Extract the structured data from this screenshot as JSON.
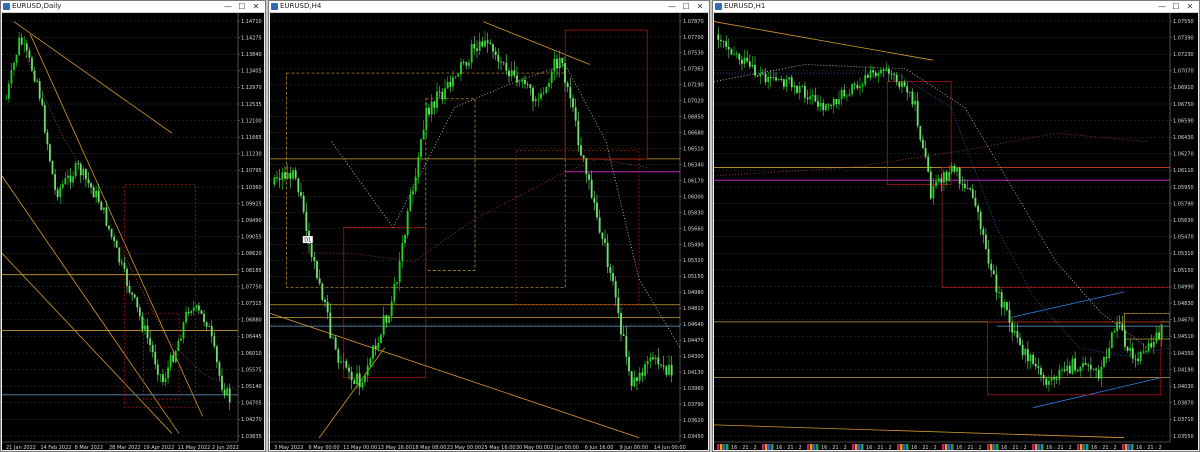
{
  "windows": [
    {
      "id": "daily",
      "title": "EURUSD,Daily",
      "price_labels": [
        "1.14710",
        "1.14275",
        "1.13840",
        "1.13405",
        "1.12970",
        "1.12535",
        "1.12100",
        "1.11665",
        "1.11230",
        "1.10795",
        "1.10360",
        "1.09925",
        "1.09490",
        "1.09055",
        "1.08620",
        "1.08185",
        "1.07750",
        "1.07315",
        "1.06880",
        "1.06445",
        "1.06010",
        "1.05575",
        "1.05140",
        "1.04705",
        "1.04270",
        "1.03835"
      ],
      "date_labels": [
        "21 Jan 2022",
        "14 Feb 2022",
        "8 Mar 2022",
        "28 Mar 2022",
        "19 Apr 2022",
        "11 May 2022",
        "2 Jun 2022"
      ]
    },
    {
      "id": "h4",
      "title": "EURUSD,H4",
      "price_labels": [
        "1.07870",
        "1.07700",
        "1.07530",
        "1.07363",
        "1.07190",
        "1.07020",
        "1.06850",
        "1.06680",
        "1.06510",
        "1.06340",
        "1.06170",
        "1.06000",
        "1.05830",
        "1.05660",
        "1.05490",
        "1.05320",
        "1.05150",
        "1.04980",
        "1.04810",
        "1.04640",
        "1.04470",
        "1.04300",
        "1.04130",
        "1.03960",
        "1.03790",
        "1.03620",
        "1.03450"
      ],
      "date_labels": [
        "3 May 2022",
        "6 May 00:00",
        "11 May 00:00",
        "13 May 16:00",
        "18 May 08:00",
        "23 May 00:00",
        "25 May 16:00",
        "30 May 00:00",
        "2 Jun 00:00",
        "6 Jun 16:00",
        "9 Jun 00:00",
        "14 Jun 00:00"
      ],
      "marker_label": "D1"
    },
    {
      "id": "h1",
      "title": "EURUSD,H1",
      "price_labels": [
        "1.07550",
        "1.07390",
        "1.07230",
        "1.07070",
        "1.06910",
        "1.06750",
        "1.06590",
        "1.06430",
        "1.06270",
        "1.06110",
        "1.05950",
        "1.05790",
        "1.05630",
        "1.05470",
        "1.05310",
        "1.05150",
        "1.04990",
        "1.04830",
        "1.04670",
        "1.04510",
        "1.04350",
        "1.04190",
        "1.04030",
        "1.03870",
        "1.03710",
        "1.03550"
      ],
      "session_label": "16 : 21 : 2"
    }
  ],
  "window_controls": {
    "minimize": "—",
    "maximize": "☐",
    "close": "✕"
  },
  "colors": {
    "bull": "#22d022",
    "bear": "#6ee06e",
    "orange": "#d39a2a",
    "red": "#c01818",
    "gold": "#c8a030",
    "magenta": "#c020c0",
    "blue": "#2a80e0",
    "grid": "#3a3a3a"
  }
}
